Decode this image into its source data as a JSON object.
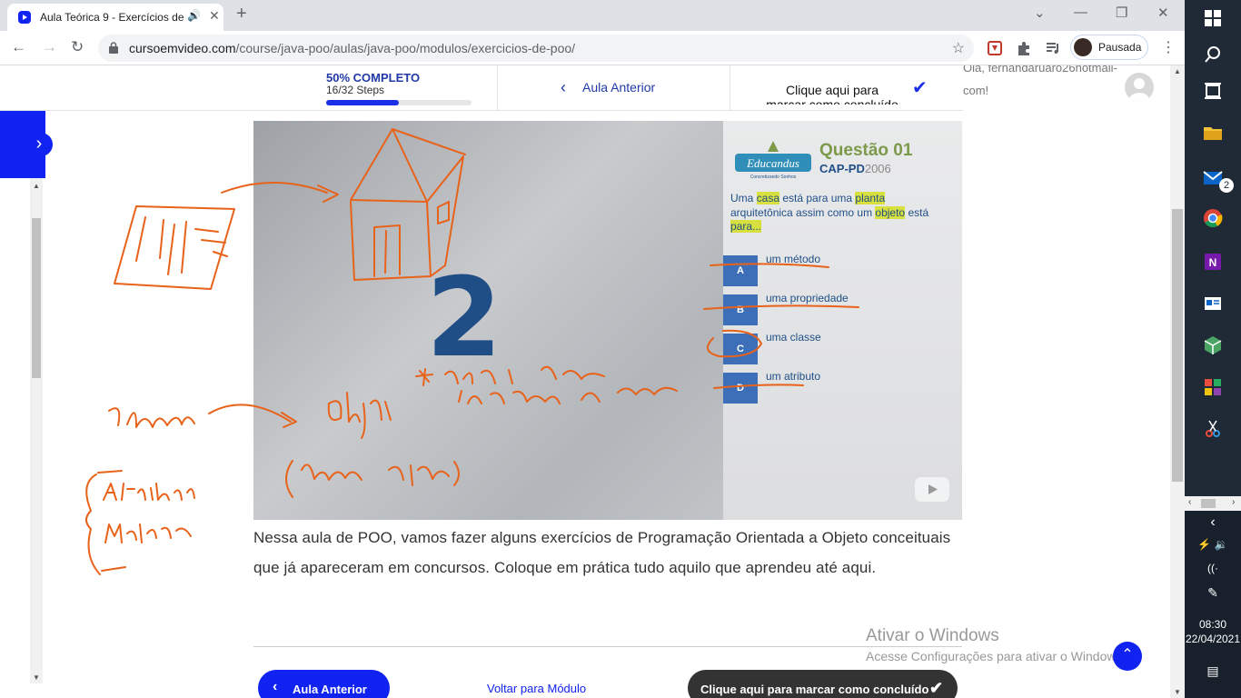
{
  "browser": {
    "tab_title": "Aula Teórica 9 - Exercícios de",
    "tab_close": "✕",
    "new_tab": "+",
    "url_domain": "cursoemvideo.com",
    "url_path": "/course/java-poo/aulas/java-poo/modulos/exercicios-de-poo/",
    "profile_label": "Pausada",
    "colors": {
      "accent": "#1023f0",
      "brand_blue": "#2039a7"
    }
  },
  "progress": {
    "percent_label": "50% COMPLETO",
    "steps_label": "16/32 Steps",
    "fraction": 0.5
  },
  "topnav": {
    "prev_label": "Aula Anterior",
    "mark_label": "Clique aqui para marcar como concluído"
  },
  "user": {
    "greeting": "Olá, fernandaruaro26hotmail-com!"
  },
  "video": {
    "big_number": "2",
    "question_title": "Questão 01",
    "question_source": "CAP-PD",
    "question_year": "2006",
    "logo_text": "Educandus",
    "logo_tagline": "Concretizando Sonhos",
    "question_parts": [
      {
        "t": "Uma ",
        "hl": false
      },
      {
        "t": "casa",
        "hl": true
      },
      {
        "t": " está para uma ",
        "hl": false
      },
      {
        "t": "planta",
        "hl": true
      },
      {
        "t": " arquitetônica assim como um ",
        "hl": false
      },
      {
        "t": "objeto",
        "hl": true
      },
      {
        "t": " está ",
        "hl": false
      },
      {
        "t": "para...",
        "hl": true
      }
    ],
    "options": [
      {
        "letter": "A",
        "text": "um método"
      },
      {
        "letter": "B",
        "text": "uma propriedade"
      },
      {
        "letter": "C",
        "text": "uma classe"
      },
      {
        "letter": "D",
        "text": "um atributo"
      }
    ]
  },
  "description": "Nessa aula de POO, vamos fazer alguns exercícios de Programação Orientada a Objeto conceituais que já apareceram em concursos. Coloque em prática tudo aquilo que aprendeu até aqui.",
  "footer_nav": {
    "prev_label": "Aula Anterior",
    "module_label": "Voltar para Módulo",
    "done_label": "Clique aqui para marcar como concluído"
  },
  "watermark": {
    "title": "Ativar o Windows",
    "subtitle": "Acesse Configurações para ativar o Windows."
  },
  "taskbar": {
    "mail_badge": "2",
    "time": "08:30",
    "date": "22/04/2021"
  }
}
